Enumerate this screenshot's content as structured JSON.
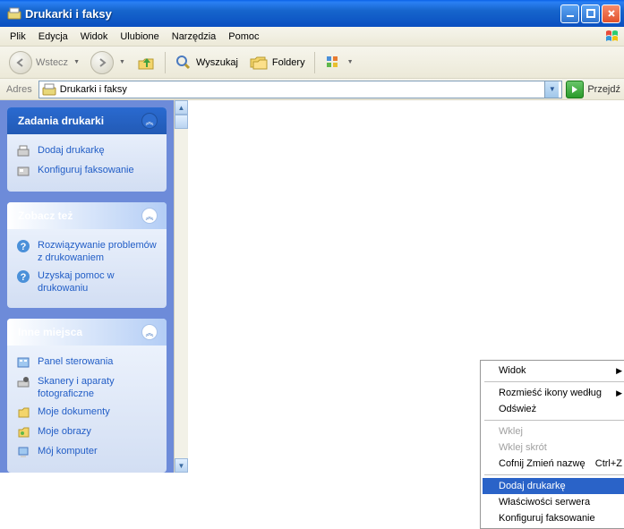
{
  "titlebar": {
    "title": "Drukarki i faksy"
  },
  "menubar": {
    "items": [
      "Plik",
      "Edycja",
      "Widok",
      "Ulubione",
      "Narzędzia",
      "Pomoc"
    ]
  },
  "toolbar": {
    "back": "Wstecz",
    "search": "Wyszukaj",
    "folders": "Foldery"
  },
  "addressbar": {
    "label": "Adres",
    "value": "Drukarki i faksy",
    "go": "Przejdź"
  },
  "sidebar": {
    "panels": [
      {
        "title": "Zadania drukarki",
        "primary": true,
        "items": [
          {
            "icon": "printer-add",
            "label": "Dodaj drukarkę"
          },
          {
            "icon": "fax-config",
            "label": "Konfiguruj faksowanie"
          }
        ]
      },
      {
        "title": "Zobacz też",
        "primary": false,
        "items": [
          {
            "icon": "help",
            "label": "Rozwiązywanie problemów z drukowaniem"
          },
          {
            "icon": "help",
            "label": "Uzyskaj pomoc w drukowaniu"
          }
        ]
      },
      {
        "title": "Inne miejsca",
        "primary": false,
        "items": [
          {
            "icon": "control-panel",
            "label": "Panel sterowania"
          },
          {
            "icon": "scanner",
            "label": "Skanery i aparaty fotograficzne"
          },
          {
            "icon": "documents",
            "label": "Moje dokumenty"
          },
          {
            "icon": "pictures",
            "label": "Moje obrazy"
          },
          {
            "icon": "computer",
            "label": "Mój komputer"
          }
        ]
      }
    ]
  },
  "context_menu": {
    "items": [
      {
        "label": "Widok",
        "submenu": true
      },
      {
        "sep": true
      },
      {
        "label": "Rozmieść ikony według",
        "submenu": true
      },
      {
        "label": "Odśwież"
      },
      {
        "sep": true
      },
      {
        "label": "Wklej",
        "disabled": true
      },
      {
        "label": "Wklej skrót",
        "disabled": true
      },
      {
        "label": "Cofnij Zmień nazwę",
        "shortcut": "Ctrl+Z"
      },
      {
        "sep": true
      },
      {
        "label": "Dodaj drukarkę",
        "highlight": true
      },
      {
        "label": "Właściwości serwera"
      },
      {
        "label": "Konfiguruj faksowanie"
      }
    ]
  }
}
